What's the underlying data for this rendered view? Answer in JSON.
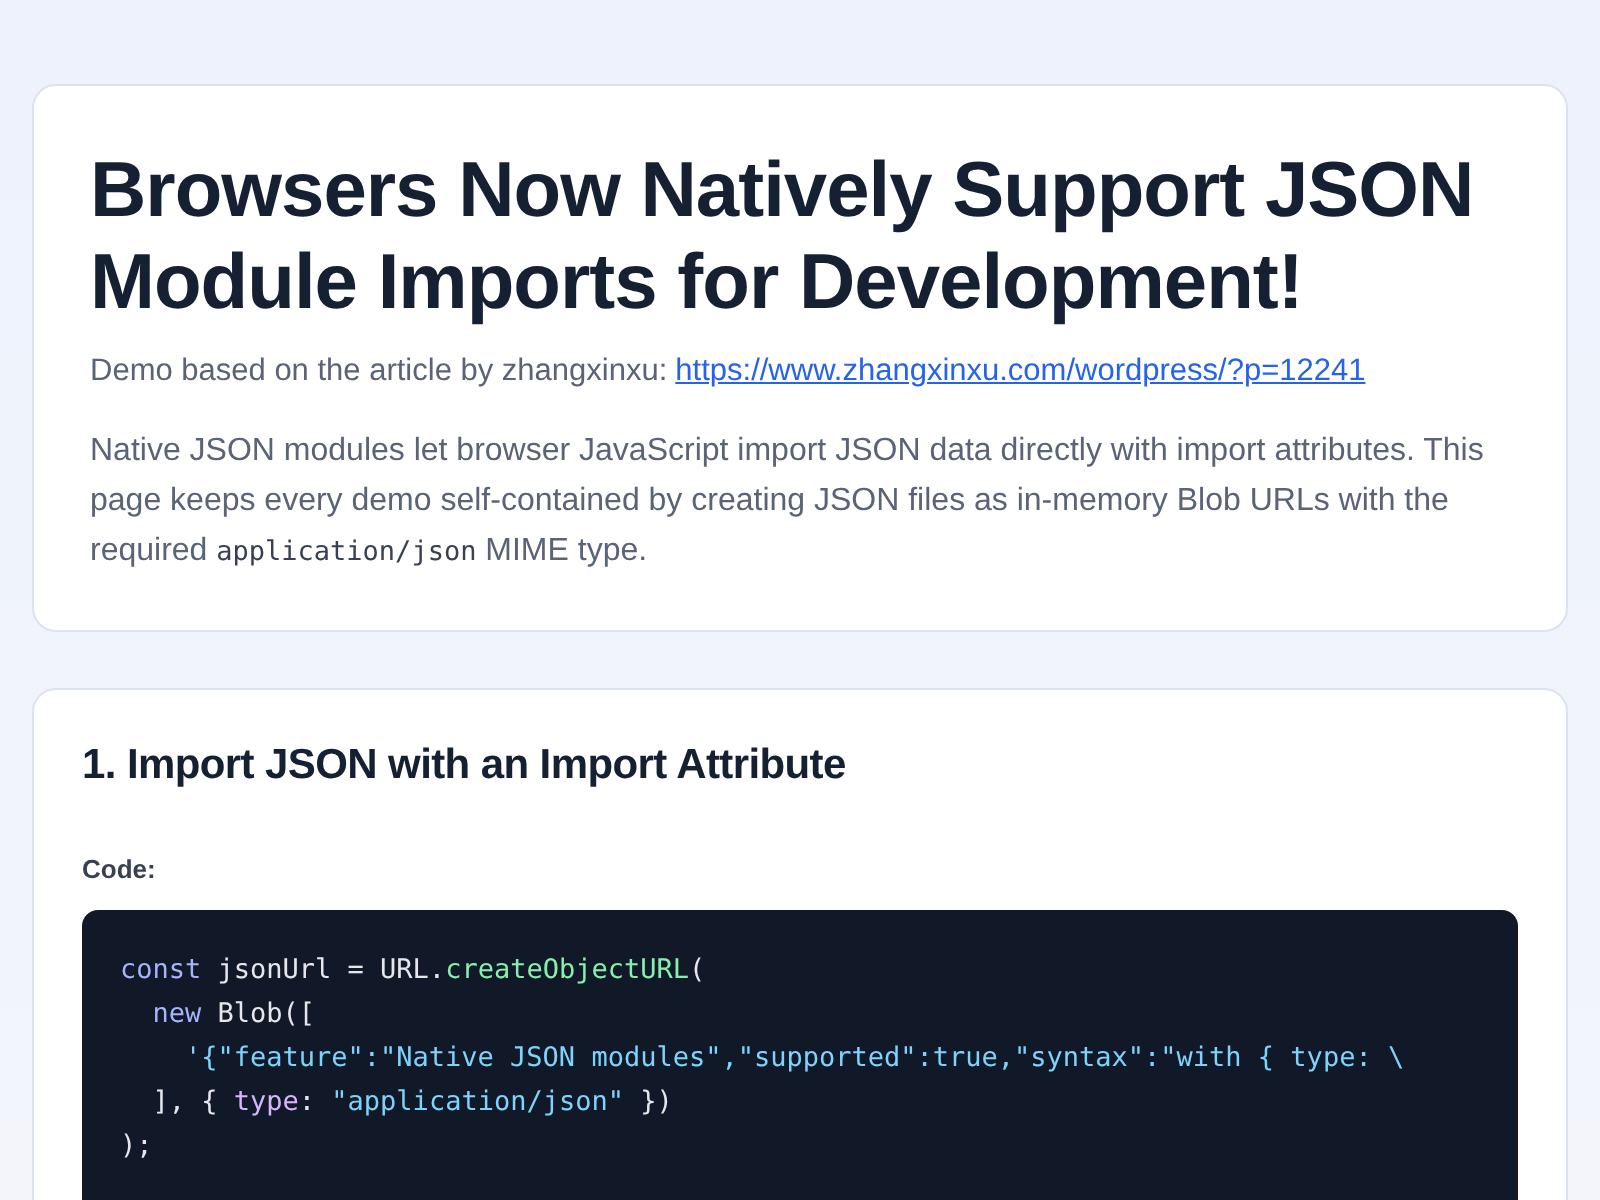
{
  "header": {
    "title": "Browsers Now Natively Support JSON Module Imports for Development!",
    "credit": {
      "text": "Demo based on the article by zhangxinxu:",
      "link": "https://www.zhangxinxu.com/wordpress/?p=12241"
    },
    "intro": [
      {
        "kind": "text",
        "text": "Native JSON modules let browser JavaScript import JSON data directly with import attributes. This page keeps every demo self-contained by creating JSON files as in-memory Blob URLs with the required "
      },
      {
        "kind": "code",
        "text": "application/json"
      },
      {
        "kind": "text",
        "text": " MIME type."
      }
    ]
  },
  "section": {
    "heading": "1. Import JSON with an Import Attribute",
    "code_label": "Code:",
    "code_lines": [
      {
        "kind": "top",
        "tokens": [
          {
            "kind": "keyword",
            "text": "const"
          },
          {
            "kind": "plain",
            "text": " jsonUrl = URL."
          },
          {
            "kind": "function",
            "text": "createObjectURL"
          },
          {
            "kind": "plain",
            "text": "("
          }
        ]
      },
      {
        "kind": "inner",
        "tokens": [
          {
            "kind": "keyword",
            "text": "new"
          },
          {
            "kind": "plain",
            "text": " Blob(["
          }
        ]
      },
      {
        "kind": "deep",
        "tokens": [
          {
            "kind": "string",
            "text": "'{\"feature\":\"Native JSON modules\",\"supported\":true,\"syntax\":\"with { type: \\"
          }
        ]
      },
      {
        "kind": "inner",
        "tokens": [
          {
            "kind": "plain",
            "text": "], { "
          },
          {
            "kind": "property",
            "text": "type"
          },
          {
            "kind": "plain",
            "text": ": "
          },
          {
            "kind": "string",
            "text": "\"application/json\""
          },
          {
            "kind": "plain",
            "text": " })"
          }
        ]
      },
      {
        "kind": "top",
        "tokens": [
          {
            "kind": "plain",
            "text": ");"
          }
        ]
      }
    ]
  }
}
